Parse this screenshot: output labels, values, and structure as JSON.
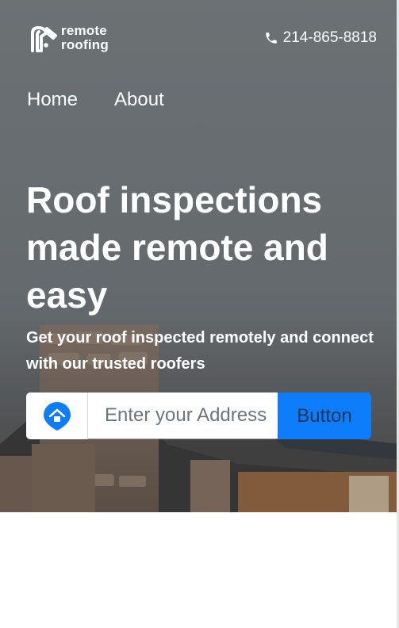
{
  "header": {
    "logo": {
      "line1": "remote",
      "line2": "roofing"
    },
    "phone": "214-865-8818"
  },
  "nav": {
    "items": [
      "Home",
      "About"
    ]
  },
  "hero": {
    "headline": "Roof inspections made remote and easy",
    "subhead": "Get your roof inspected remotely and connect with our trusted roofers"
  },
  "search": {
    "icon": "home-pin-icon",
    "placeholder": "Enter your Address",
    "button_label": "Button"
  },
  "colors": {
    "accent": "#0d7dfc",
    "text_on_hero": "#ffffff"
  }
}
